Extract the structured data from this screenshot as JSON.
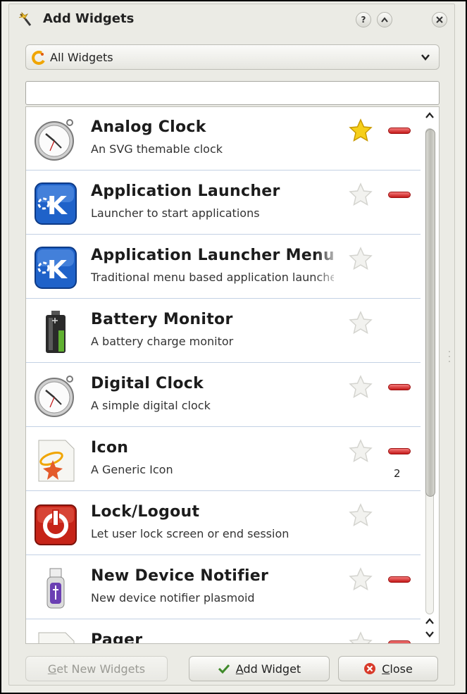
{
  "window": {
    "title": "Add Widgets",
    "help_label": "?",
    "collapse_label": "^",
    "close_label": "x"
  },
  "filter": {
    "selected": "All Widgets"
  },
  "search": {
    "value": "",
    "placeholder": ""
  },
  "widgets": [
    {
      "name": "Analog Clock",
      "description": "An SVG themable clock",
      "icon": "analog-clock-icon",
      "favorite": true,
      "removable": true,
      "count": ""
    },
    {
      "name": "Application Launcher",
      "description": "Launcher to start applications",
      "icon": "kde-launcher-icon",
      "favorite": false,
      "removable": true,
      "count": ""
    },
    {
      "name": "Application Launcher Menu",
      "description": "Traditional menu based application launcher",
      "icon": "kde-launcher-icon",
      "favorite": false,
      "removable": false,
      "count": ""
    },
    {
      "name": "Battery Monitor",
      "description": "A battery charge monitor",
      "icon": "battery-icon",
      "favorite": false,
      "removable": false,
      "count": ""
    },
    {
      "name": "Digital Clock",
      "description": "A simple digital clock",
      "icon": "analog-clock-icon",
      "favorite": false,
      "removable": true,
      "count": ""
    },
    {
      "name": "Icon",
      "description": "A Generic Icon",
      "icon": "generic-icon",
      "favorite": false,
      "removable": true,
      "count": "2"
    },
    {
      "name": "Lock/Logout",
      "description": "Let user lock screen or end session",
      "icon": "power-icon",
      "favorite": false,
      "removable": false,
      "count": ""
    },
    {
      "name": "New Device Notifier",
      "description": "New device notifier plasmoid",
      "icon": "usb-device-icon",
      "favorite": false,
      "removable": true,
      "count": ""
    },
    {
      "name": "Pager",
      "description": "",
      "icon": "generic-icon",
      "favorite": false,
      "removable": true,
      "count": ""
    }
  ],
  "buttons": {
    "get_new": "Get New Widgets",
    "add": "Add Widget",
    "close": "Close"
  },
  "colors": {
    "remove": "#d42a2a",
    "favorite": "#f5c816",
    "row_divider": "#c3d1e4"
  }
}
